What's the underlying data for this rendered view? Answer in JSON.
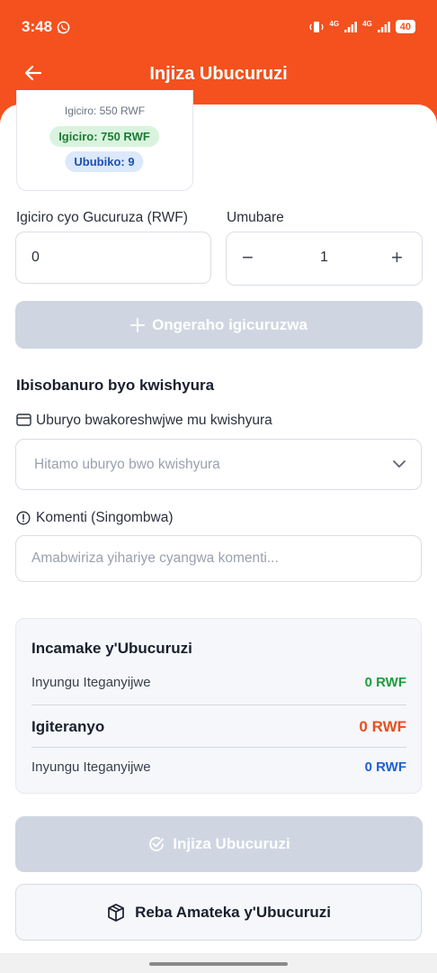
{
  "status_bar": {
    "time": "3:48",
    "battery": "40",
    "network_1": "4G",
    "network_2": "4G"
  },
  "header": {
    "title": "Injiza Ubucuruzi"
  },
  "product_card": {
    "price_old": "Igiciro: 550 RWF",
    "price_new": "Igiciro: 750 RWF",
    "stock": "Ububiko: 9"
  },
  "form": {
    "sell_price_label": "Igiciro cyo Gucuruza (RWF)",
    "sell_price_value": "0",
    "quantity_label": "Umubare",
    "quantity_value": "1",
    "quantity_minus": "−",
    "quantity_plus": "+",
    "add_product_label": "Ongeraho igicuruzwa"
  },
  "payment": {
    "section_title": "Ibisobanuro byo kwishyura",
    "method_label": "Uburyo bwakoreshwjwe mu kwishyura",
    "method_placeholder": "Hitamo uburyo bwo kwishyura",
    "comment_label": "Komenti (Singombwa)",
    "comment_placeholder": "Amabwiriza yihariye cyangwa komenti..."
  },
  "summary": {
    "title": "Incamake y'Ubucuruzi",
    "rows": [
      {
        "label": "Inyungu Iteganyijwe",
        "value": "0 RWF"
      },
      {
        "label": "Igiteranyo",
        "value": "0 RWF"
      },
      {
        "label": "Inyungu Iteganyijwe",
        "value": "0 RWF"
      }
    ]
  },
  "actions": {
    "submit_label": "Injiza Ubucuruzi",
    "history_label": "Reba Amateka y'Ubucuruzi"
  },
  "colors": {
    "brand": "#f4511e",
    "profit_green": "#1e9b3c",
    "total_orange": "#e8501c",
    "profit_blue": "#1f5fd1"
  }
}
